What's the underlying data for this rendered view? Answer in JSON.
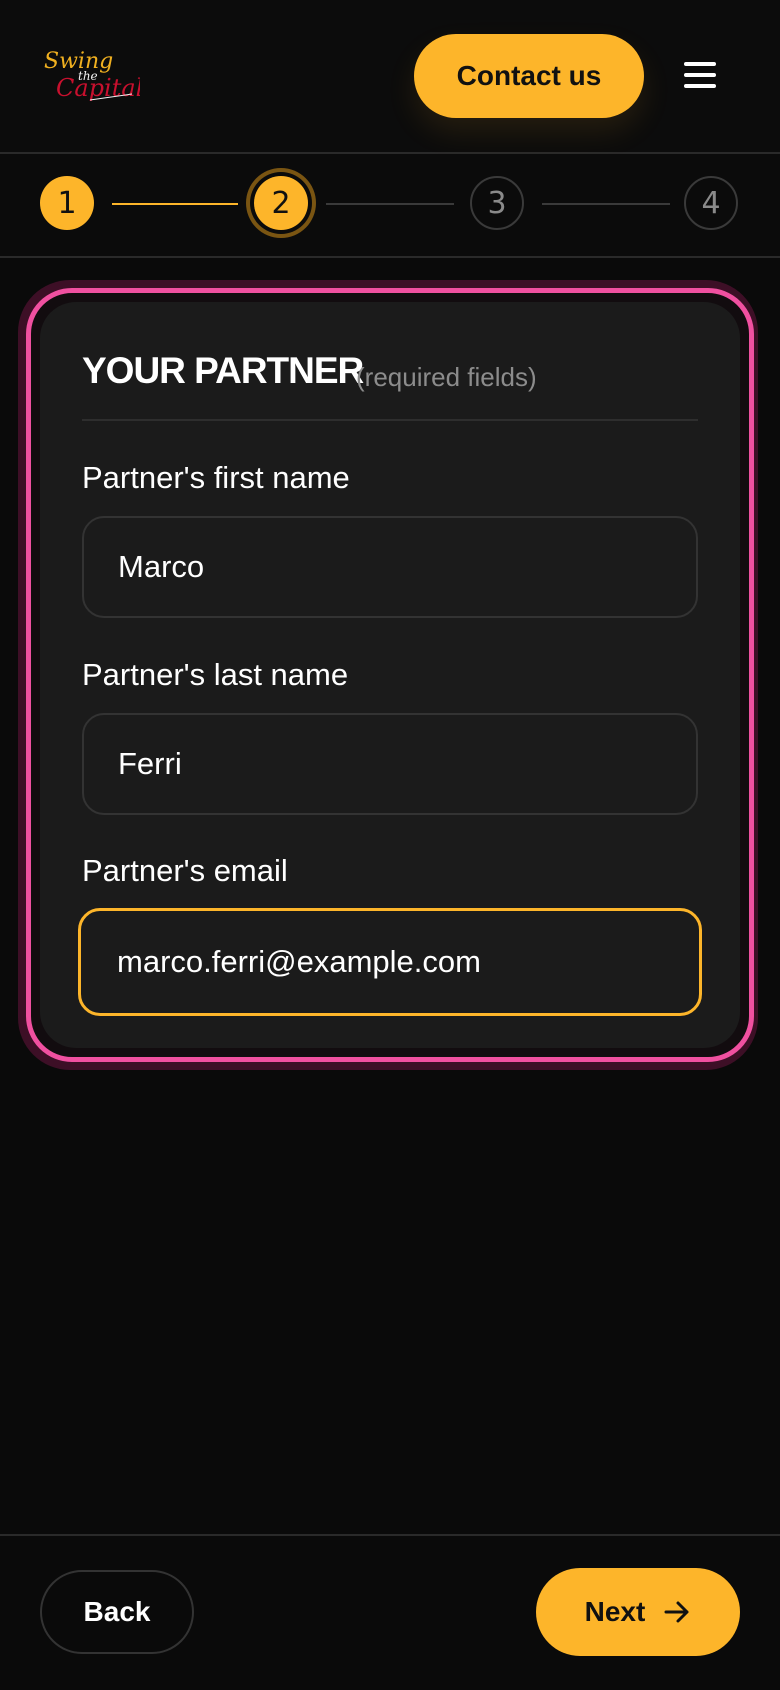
{
  "header": {
    "logo_alt": "Swing the Capital",
    "contact_label": "Contact us",
    "menu_icon": "hamburger-menu-icon"
  },
  "stepper": {
    "steps": [
      {
        "number": "1",
        "state": "done"
      },
      {
        "number": "2",
        "state": "active"
      },
      {
        "number": "3",
        "state": "pending"
      },
      {
        "number": "4",
        "state": "pending"
      }
    ],
    "current_step": 2,
    "total_steps": 4
  },
  "form": {
    "title": "YOUR PARTNER",
    "subtitle": "(required fields)",
    "fields": [
      {
        "label": "Partner's first name",
        "value": "Marco"
      },
      {
        "label": "Partner's last name",
        "value": "Ferri"
      },
      {
        "label": "Partner's email",
        "value": "marco.ferri@example.com"
      }
    ]
  },
  "footer": {
    "back_label": "Back",
    "next_label": "Next",
    "next_icon": "arrow-right-icon"
  },
  "colors": {
    "accent": "#fdb52a",
    "card_border": "#f050a0",
    "background": "#0a0a0a",
    "card_background": "#1b1b1b"
  }
}
